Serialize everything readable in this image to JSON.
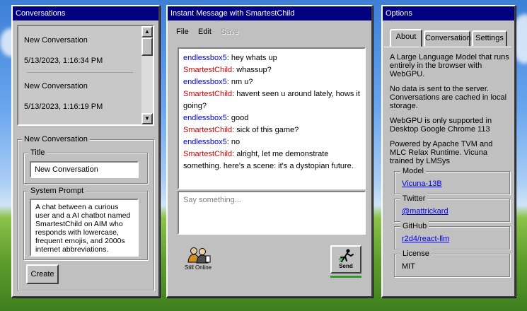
{
  "conversations": {
    "title": "Conversations",
    "items": [
      {
        "title": "New Conversation",
        "date": "5/13/2023, 1:16:34 PM"
      },
      {
        "title": "New Conversation",
        "date": "5/13/2023, 1:16:19 PM"
      }
    ],
    "scroll_up": "▲",
    "scroll_down": "▼"
  },
  "editor": {
    "group_label": "New Conversation",
    "title_label": "Title",
    "title_value": "New Conversation",
    "prompt_label": "System Prompt",
    "prompt_value": "A chat between a curious user and a AI chatbot named SmartestChild on AIM who responds with lowercase, frequent emojis, and 2000s internet abbreviations.",
    "create_button": "Create"
  },
  "chat": {
    "title": "Instant Message with SmartestChild",
    "menu": {
      "file": "File",
      "edit": "Edit",
      "save": "Save"
    },
    "messages": [
      {
        "user": "endlessbox5",
        "kind": "user",
        "text": " hey whats up"
      },
      {
        "user": "SmartestChild",
        "kind": "bot",
        "text": " whassup?"
      },
      {
        "user": "endlessbox5",
        "kind": "user",
        "text": " nm u?"
      },
      {
        "user": "SmartestChild",
        "kind": "bot",
        "text": " havent seen u around lately, hows it going?"
      },
      {
        "user": "endlessbox5",
        "kind": "user",
        "text": " good"
      },
      {
        "user": "SmartestChild",
        "kind": "bot",
        "text": " sick of this game?"
      },
      {
        "user": "endlessbox5",
        "kind": "user",
        "text": " no"
      },
      {
        "user": "SmartestChild",
        "kind": "bot",
        "text": " alright, let me demonstrate something. here's a scene: it's a dystopian future."
      }
    ],
    "input_placeholder": "Say something...",
    "status_label": "Still Online",
    "send_label": "Send",
    "user_icon": "aim-people-icon",
    "send_icon": "running-man-icon"
  },
  "options": {
    "title": "Options",
    "tabs": [
      "About",
      "Conversation",
      "Settings"
    ],
    "active_tab": "About",
    "about": [
      "A Large Language Model that runs entirely in the browser with WebGPU.",
      "No data is sent to the server. Conversations are cached in local storage.",
      "WebGPU is only supported in Desktop Google Chrome 113",
      "Powered by Apache TVM and MLC Relax Runtime. Vicuna trained by LMSys"
    ],
    "model": {
      "label": "Model",
      "value": "Vicuna-13B"
    },
    "twitter": {
      "label": "Twitter",
      "value": "@mattrickard"
    },
    "github": {
      "label": "GitHub",
      "value": "r2d4/react-llm"
    },
    "license": {
      "label": "License",
      "value": "MIT"
    }
  },
  "colors": {
    "titlebar": "#000080",
    "window": "#c0c0c0",
    "user_name": "#0000cc",
    "bot_name": "#cc0000",
    "link": "#0000ee"
  }
}
